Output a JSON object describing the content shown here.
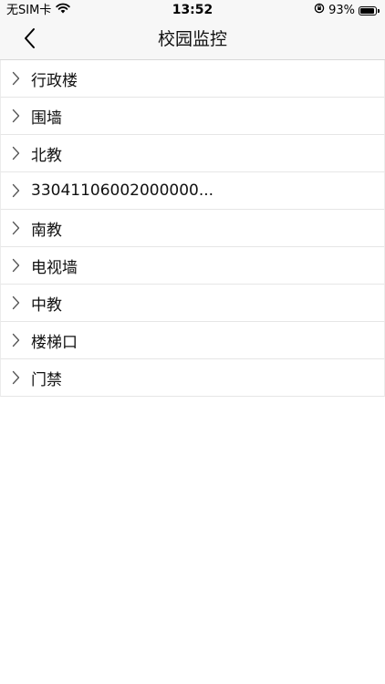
{
  "status_bar": {
    "carrier": "无SIM卡",
    "time": "13:52",
    "battery": "93%",
    "battery_level": 0.93
  },
  "nav": {
    "title": "校园监控",
    "back_icon": "chevron-left-icon"
  },
  "items": [
    {
      "label": "行政楼"
    },
    {
      "label": "围墙"
    },
    {
      "label": "北教"
    },
    {
      "label": "33041106002000000..."
    },
    {
      "label": "南教"
    },
    {
      "label": "电视墙"
    },
    {
      "label": "中教"
    },
    {
      "label": "楼梯口"
    },
    {
      "label": "门禁"
    }
  ],
  "icons": {
    "item_icon": "chevron-right-icon",
    "wifi": "wifi-icon",
    "orientation_lock": "orientation-lock-icon",
    "battery": "battery-icon"
  }
}
